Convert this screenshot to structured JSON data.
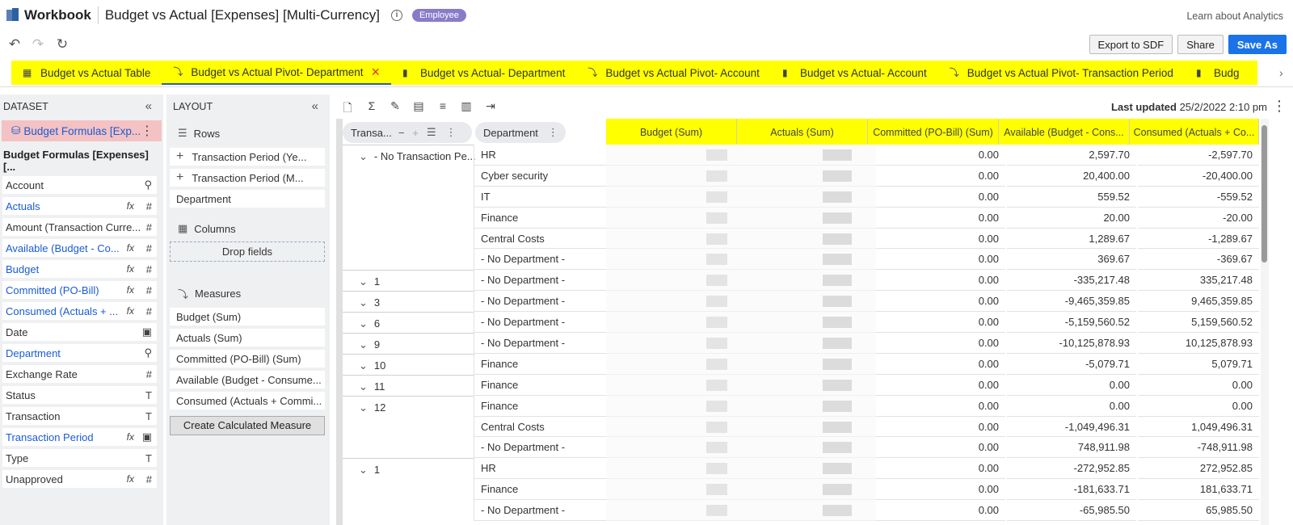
{
  "header": {
    "app_name": "Workbook",
    "title": "Budget vs Actual [Expenses] [Multi-Currency]",
    "badge": "Employee",
    "learn_link": "Learn about Analytics"
  },
  "toolbar": {
    "export_label": "Export to SDF",
    "share_label": "Share",
    "save_as_label": "Save As"
  },
  "tabs": [
    {
      "label": "Budget vs Actual Table",
      "icon": "table-icon"
    },
    {
      "label": "Budget vs Actual Pivot- Department",
      "icon": "pivot-icon",
      "active": true
    },
    {
      "label": "Budget vs Actual- Department",
      "icon": "bar-chart-icon"
    },
    {
      "label": "Budget vs Actual Pivot- Account",
      "icon": "pivot-icon"
    },
    {
      "label": "Budget vs Actual- Account",
      "icon": "bar-chart-icon"
    },
    {
      "label": "Budget vs Actual Pivot- Transaction Period",
      "icon": "pivot-icon"
    },
    {
      "label": "Budg",
      "icon": "bar-chart-icon"
    }
  ],
  "dataset": {
    "heading": "DATASET",
    "selected": "Budget Formulas [Exp...",
    "name": "Budget Formulas [Expenses] [...",
    "fields": [
      {
        "label": "Account",
        "icon": "hierarchy-icon",
        "calc": false
      },
      {
        "label": "Actuals",
        "icon": "number-icon",
        "calc": true
      },
      {
        "label": "Amount (Transaction Curre...",
        "icon": "number-icon",
        "calc": false
      },
      {
        "label": "Available (Budget - Co...",
        "icon": "number-icon",
        "calc": true
      },
      {
        "label": "Budget",
        "icon": "number-icon",
        "calc": true
      },
      {
        "label": "Committed (PO-Bill)",
        "icon": "number-icon",
        "calc": true
      },
      {
        "label": "Consumed (Actuals + ...",
        "icon": "number-icon",
        "calc": true
      },
      {
        "label": "Date",
        "icon": "calendar-icon",
        "calc": false
      },
      {
        "label": "Department",
        "icon": "hierarchy-icon",
        "calc": true,
        "nofx": true
      },
      {
        "label": "Exchange Rate",
        "icon": "number-icon",
        "calc": false
      },
      {
        "label": "Status",
        "icon": "text-icon",
        "calc": false
      },
      {
        "label": "Transaction",
        "icon": "text-icon",
        "calc": false
      },
      {
        "label": "Transaction Period",
        "icon": "calendar-icon",
        "calc": true
      },
      {
        "label": "Type",
        "icon": "text-icon",
        "calc": false
      },
      {
        "label": "Unapproved",
        "icon": "number-icon",
        "calc": false,
        "fx": true
      }
    ]
  },
  "layout": {
    "heading": "LAYOUT",
    "rows_label": "Rows",
    "rows": [
      "Transaction Period  (Ye...",
      "Transaction Period  (M...",
      "Department"
    ],
    "columns_label": "Columns",
    "drop_label": "Drop fields",
    "measures_label": "Measures",
    "measures": [
      "Budget  (Sum)",
      "Actuals  (Sum)",
      "Committed (PO-Bill)  (Sum)",
      "Available (Budget - Consume...",
      "Consumed (Actuals + Commi..."
    ],
    "calc_button": "Create Calculated Measure"
  },
  "main": {
    "last_updated_label": "Last updated",
    "last_updated_value": "25/2/2022 2:10 pm",
    "pill_tp": "Transa...",
    "pill_dept": "Department",
    "columns": [
      "Budget (Sum)",
      "Actuals (Sum)",
      "Committed (PO-Bill) (Sum)",
      "Available (Budget - Cons...",
      "Consumed (Actuals + Co..."
    ],
    "rows": [
      {
        "tp": "- No Transaction Pe...",
        "dept": "HR",
        "committed": "0.00",
        "available": "2,597.70",
        "consumed": "-2,597.70"
      },
      {
        "tp": "",
        "dept": "Cyber security",
        "committed": "0.00",
        "available": "20,400.00",
        "consumed": "-20,400.00"
      },
      {
        "tp": "",
        "dept": "IT",
        "committed": "0.00",
        "available": "559.52",
        "consumed": "-559.52"
      },
      {
        "tp": "",
        "dept": "Finance",
        "committed": "0.00",
        "available": "20.00",
        "consumed": "-20.00"
      },
      {
        "tp": "",
        "dept": "Central Costs",
        "committed": "0.00",
        "available": "1,289.67",
        "consumed": "-1,289.67"
      },
      {
        "tp": "",
        "dept": "- No Department -",
        "committed": "0.00",
        "available": "369.67",
        "consumed": "-369.67"
      },
      {
        "tp": "1",
        "dept": "- No Department -",
        "committed": "0.00",
        "available": "-335,217.48",
        "consumed": "335,217.48"
      },
      {
        "tp": "3",
        "dept": "- No Department -",
        "committed": "0.00",
        "available": "-9,465,359.85",
        "consumed": "9,465,359.85"
      },
      {
        "tp": "6",
        "dept": "- No Department -",
        "committed": "0.00",
        "available": "-5,159,560.52",
        "consumed": "5,159,560.52"
      },
      {
        "tp": "9",
        "dept": "- No Department -",
        "committed": "0.00",
        "available": "-10,125,878.93",
        "consumed": "10,125,878.93"
      },
      {
        "tp": "10",
        "dept": "Finance",
        "committed": "0.00",
        "available": "-5,079.71",
        "consumed": "5,079.71"
      },
      {
        "tp": "11",
        "dept": "Finance",
        "committed": "0.00",
        "available": "0.00",
        "consumed": "0.00"
      },
      {
        "tp": "12",
        "dept": "Finance",
        "committed": "0.00",
        "available": "0.00",
        "consumed": "0.00"
      },
      {
        "tp": "",
        "dept": "Central Costs",
        "committed": "0.00",
        "available": "-1,049,496.31",
        "consumed": "1,049,496.31"
      },
      {
        "tp": "",
        "dept": "- No Department -",
        "committed": "0.00",
        "available": "748,911.98",
        "consumed": "-748,911.98"
      },
      {
        "tp": "1",
        "dept": "HR",
        "committed": "0.00",
        "available": "-272,952.85",
        "consumed": "272,952.85"
      },
      {
        "tp": "",
        "dept": "Finance",
        "committed": "0.00",
        "available": "-181,633.71",
        "consumed": "181,633.71"
      },
      {
        "tp": "",
        "dept": "- No Department -",
        "committed": "0.00",
        "available": "-65,985.50",
        "consumed": "65,985.50"
      }
    ]
  },
  "colors": {
    "highlight": "#ffff00",
    "accent": "#1a73e8",
    "link": "#1a5bd6",
    "badge": "#8a7bc9",
    "panel_bg": "#eef0f2"
  }
}
